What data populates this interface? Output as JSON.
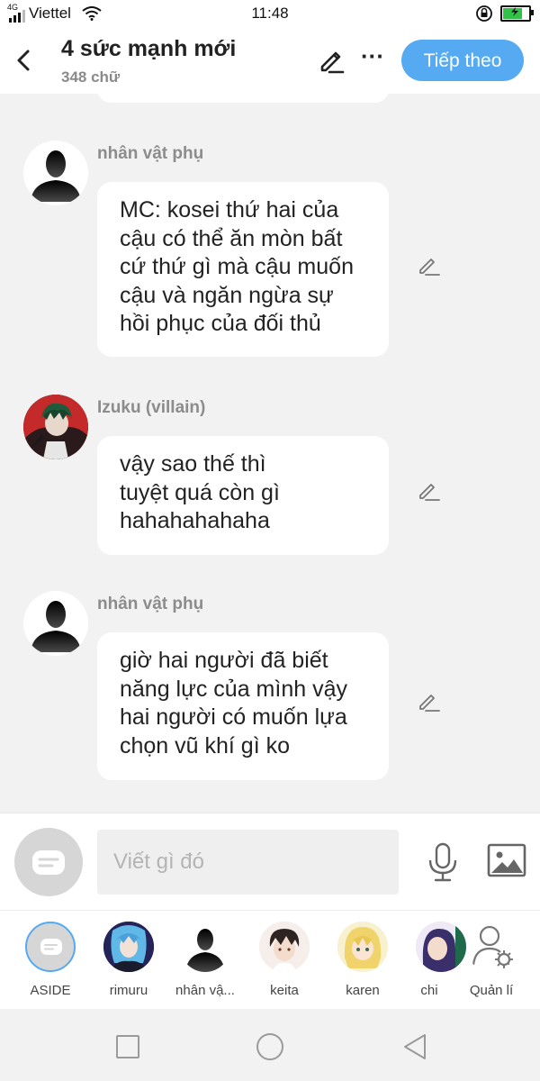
{
  "status_bar": {
    "network_type": "4G",
    "carrier": "Viettel",
    "time": "11:48",
    "battery_level": 0.7,
    "battery_color": "#31c24a"
  },
  "header": {
    "title": "4 sức mạnh mới",
    "subtitle": "348 chữ",
    "next_label": "Tiếp theo",
    "more_label": "···"
  },
  "messages": [
    {
      "sender": "nhân vật phụ",
      "avatar": "silhouette-avatar",
      "lines": [
        "MC: kosei thứ hai của",
        "cậu có thể ăn mòn bất",
        "cứ thứ gì mà cậu muốn",
        "cậu và ngăn ngừa sự",
        "hồi phục của đối thủ"
      ]
    },
    {
      "sender": "Izuku (villain)",
      "avatar": "villain-avatar",
      "lines": [
        "vậy sao thế thì",
        "tuyệt quá còn gì",
        "hahahahahaha"
      ]
    },
    {
      "sender": "nhân vật phụ",
      "avatar": "silhouette-avatar",
      "lines": [
        "giờ hai người đã biết",
        "năng lực của mình vậy",
        "hai người có muốn lựa",
        "chọn vũ khí gì ko"
      ]
    }
  ],
  "input": {
    "placeholder": "Viết gì đó"
  },
  "characters": [
    {
      "name": "ASIDE"
    },
    {
      "name": "rimuru"
    },
    {
      "name": "nhân vậ..."
    },
    {
      "name": "keita"
    },
    {
      "name": "karen"
    },
    {
      "name": "chi"
    },
    {
      "name": "Quản lí"
    }
  ],
  "colors": {
    "accent": "#55aaf2",
    "background": "#f2f2f2",
    "bubble": "#ffffff"
  }
}
